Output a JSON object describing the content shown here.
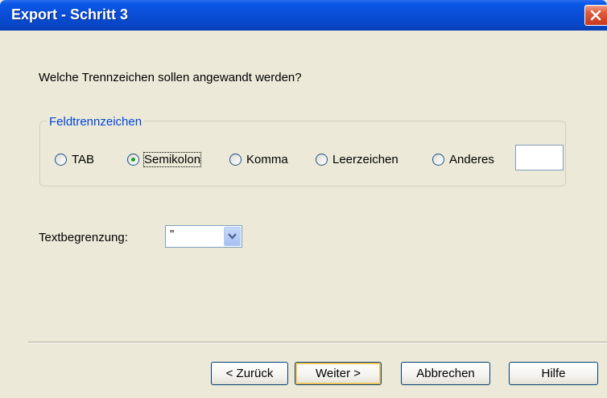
{
  "window": {
    "title": "Export - Schritt 3"
  },
  "question": "Welche Trennzeichen sollen angewandt werden?",
  "field_separator": {
    "legend": "Feldtrennzeichen",
    "options": [
      {
        "label": "TAB",
        "checked": false
      },
      {
        "label": "Semikolon",
        "checked": true
      },
      {
        "label": "Komma",
        "checked": false
      },
      {
        "label": "Leerzeichen",
        "checked": false
      },
      {
        "label": "Anderes",
        "checked": false
      }
    ],
    "other_value": ""
  },
  "text_qualifier": {
    "label": "Textbegrenzung:",
    "value": "\""
  },
  "buttons": {
    "back": "< Zurück",
    "next": "Weiter >",
    "cancel": "Abbrechen",
    "help": "Hilfe"
  },
  "icons": {
    "close": "close-icon",
    "dropdown": "chevron-down-icon"
  },
  "colors": {
    "title_bar": "#0a4ed8",
    "dialog_bg": "#ece9d8",
    "legend_text": "#0046d5",
    "close_button": "#d9532f"
  }
}
